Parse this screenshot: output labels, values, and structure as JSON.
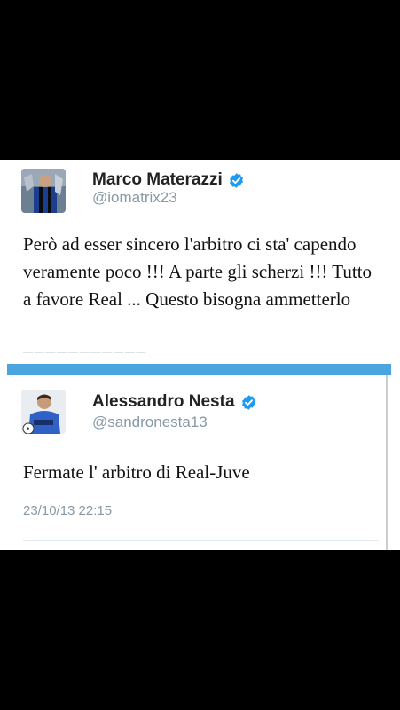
{
  "tweet1": {
    "display_name": "Marco Materazzi",
    "handle": "@iomatrix23",
    "text": "Però ad esser sincero l'arbitro ci sta' capendo veramente poco !!! A parte gli scherzi !!! Tutto a favore Real ... Questo bisogna ammetterlo",
    "avatar_icon": "player-photo-icon",
    "verified_icon": "verified-badge-icon"
  },
  "tweet2": {
    "display_name": "Alessandro Nesta",
    "handle": "@sandronesta13",
    "text": "Fermate l' arbitro di Real-Juve",
    "timestamp": "23/10/13 22:15",
    "avatar_icon": "player-photo-icon",
    "verified_icon": "verified-badge-icon"
  },
  "colors": {
    "accent_blue": "#4aa4dd",
    "verified_blue": "#1d9bf0",
    "muted_gray": "#8899a6",
    "background": "#000000"
  }
}
